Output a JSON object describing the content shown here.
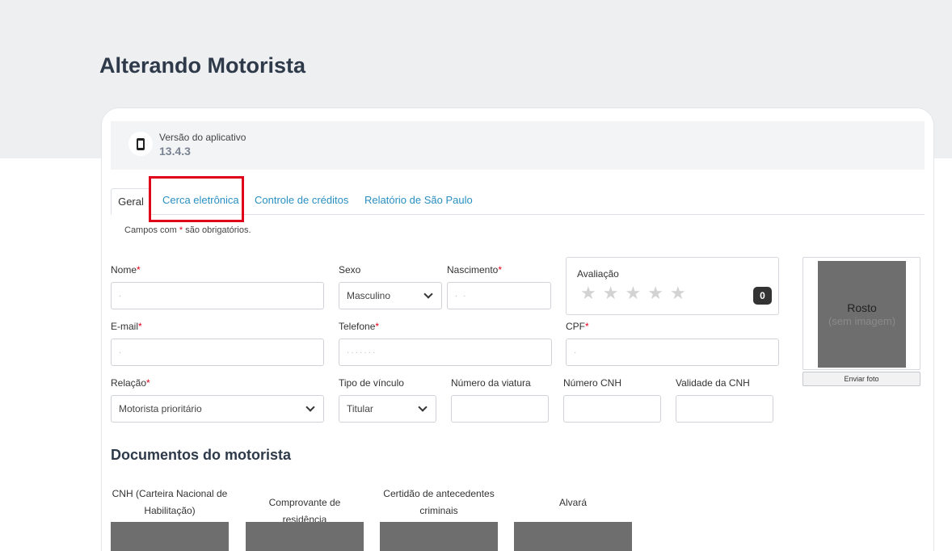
{
  "page": {
    "title": "Alterando Motorista"
  },
  "version": {
    "label": "Versão do aplicativo",
    "value": "13.4.3",
    "icon": "phone-icon"
  },
  "tabs": [
    {
      "label": "Geral",
      "active": true
    },
    {
      "label": "Cerca eletrônica"
    },
    {
      "label": "Controle de créditos"
    },
    {
      "label": "Relatório de São Paulo"
    }
  ],
  "form": {
    "required_prefix": "Campos com ",
    "required_mark": "*",
    "required_suffix": " são obrigatórios.",
    "nome": {
      "label": "Nome",
      "value": "·"
    },
    "sexo": {
      "label": "Sexo",
      "value": "Masculino"
    },
    "nascimento": {
      "label": "Nascimento",
      "value": "·          ·"
    },
    "email": {
      "label": "E-mail",
      "value": "·"
    },
    "telefone": {
      "label": "Telefone",
      "value": "·······"
    },
    "cpf": {
      "label": "CPF",
      "value": "·"
    },
    "relacao": {
      "label": "Relação",
      "value": "Motorista prioritário"
    },
    "tipo_vinculo": {
      "label": "Tipo de vínculo",
      "value": "Titular"
    },
    "numero_viatura": {
      "label": "Número da viatura",
      "value": ""
    },
    "numero_cnh": {
      "label": "Número CNH",
      "value": ""
    },
    "validade_cnh": {
      "label": "Validade da CNH",
      "value": ""
    }
  },
  "rating": {
    "label": "Avaliação",
    "stars_total": 5,
    "stars_filled": 0,
    "count": "0"
  },
  "photo": {
    "title": "Rosto",
    "subtitle": "(sem imagem)",
    "button": "Enviar foto"
  },
  "documents": {
    "title": "Documentos do motorista",
    "items": [
      {
        "label": "CNH (Carteira Nacional de Habilitação)"
      },
      {
        "label": "Comprovante de residência"
      },
      {
        "label": "Certidão de antecedentes criminais"
      },
      {
        "label": "Alvará"
      }
    ]
  },
  "colors": {
    "accent": "#2a8fc1",
    "required": "#e0001a",
    "highlight": "#e0001a"
  }
}
